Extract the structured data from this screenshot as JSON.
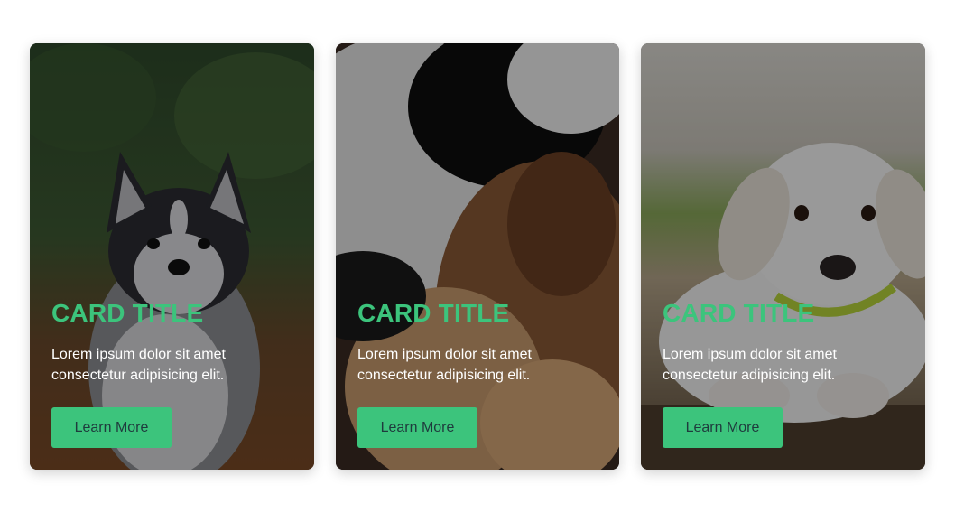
{
  "cards": [
    {
      "title": "CARD TITLE",
      "text": "Lorem ipsum dolor sit amet consectetur adipisicing elit.",
      "button_label": "Learn More",
      "image": "husky-puppy-photo"
    },
    {
      "title": "CARD TITLE",
      "text": "Lorem ipsum dolor sit amet consectetur adipisicing elit.",
      "button_label": "Learn More",
      "image": "sleeping-dogs-photo"
    },
    {
      "title": "CARD TITLE",
      "text": "Lorem ipsum dolor sit amet consectetur adipisicing elit.",
      "button_label": "Learn More",
      "image": "white-puppy-photo"
    }
  ],
  "colors": {
    "accent": "#3cc47c",
    "button_text": "#1f3b3d",
    "body_text": "#ffffff"
  }
}
